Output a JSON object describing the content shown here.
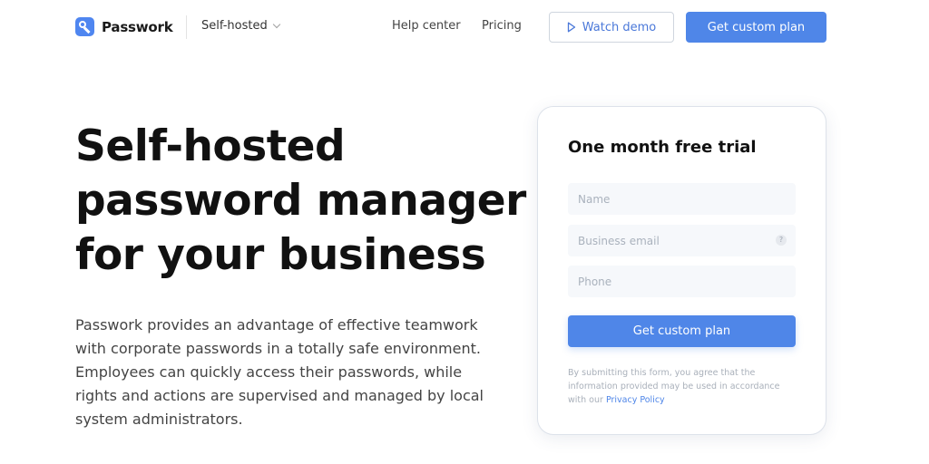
{
  "header": {
    "brand": "Passwork",
    "product_select": "Self-hosted",
    "nav": {
      "help_center": "Help center",
      "pricing": "Pricing"
    },
    "watch_demo": "Watch demo",
    "get_custom_plan": "Get custom plan"
  },
  "hero": {
    "title_line1": "Self-hosted",
    "title_line2": "password manager",
    "title_line3": "for your business",
    "description": "Passwork provides an advantage of effective teamwork with corporate passwords in a totally safe environment. Employees can quickly access their passwords, while rights and actions are supervised and managed by local system administrators."
  },
  "trial_form": {
    "title": "One month free trial",
    "name_placeholder": "Name",
    "email_placeholder": "Business email",
    "phone_placeholder": "Phone",
    "help_glyph": "?",
    "submit_label": "Get custom plan",
    "disclaimer_text": "By submitting this form, you agree that the information provided may be used in accordance with our ",
    "privacy_link": "Privacy Policy"
  },
  "colors": {
    "accent": "#4f86e8",
    "text_primary": "#111111",
    "text_secondary": "#444444",
    "muted": "#a9b0ba"
  }
}
